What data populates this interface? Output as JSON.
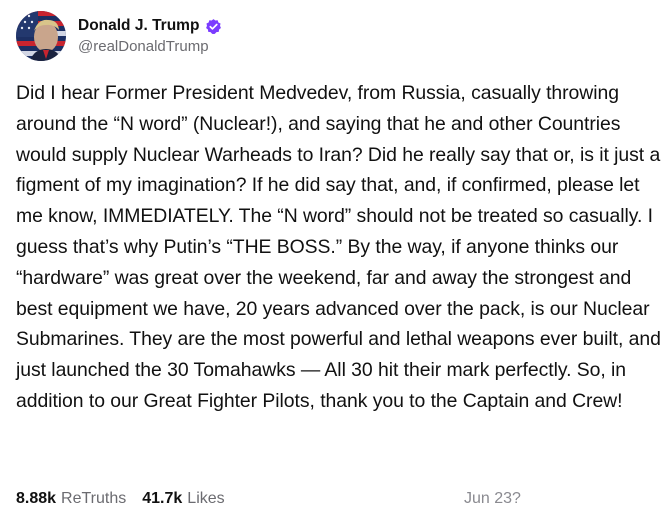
{
  "user": {
    "display_name": "Donald J. Trump",
    "handle": "@realDonaldTrump",
    "verified_icon": "verified-badge-icon",
    "verified_color": "#7b3cff",
    "avatar": "avatar-image"
  },
  "post": {
    "text": "Did I hear Former President Medvedev, from Russia, casually throwing around the “N word” (Nuclear!), and saying that he and other Countries would supply Nuclear Warheads to Iran? Did he really say that or, is it just a figment of my imagination? If he did say that, and, if confirmed, please let me know, IMMEDIATELY. The “N word” should not be treated so casually. I guess that’s why Putin’s “THE BOSS.” By the way, if anyone thinks our “hardware” was great over the weekend, far and away the strongest and best equipment we have, 20 years advanced over the pack, is our Nuclear Submarines. They are the most powerful and lethal weapons ever built, and just launched the 30 Tomahawks — All 30 hit their mark perfectly. So, in addition to our Great Fighter Pilots, thank you to the Captain and Crew!"
  },
  "stats": {
    "retruths_count": "8.88k",
    "retruths_label": "ReTruths",
    "likes_count": "41.7k",
    "likes_label": "Likes"
  },
  "timestamp": "Jun 23?"
}
